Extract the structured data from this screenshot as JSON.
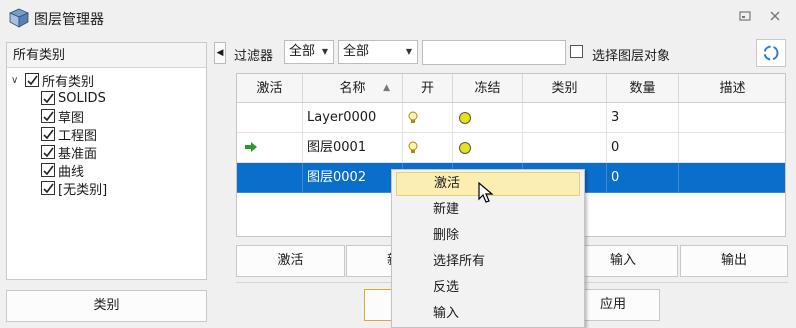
{
  "window": {
    "title": "图层管理器",
    "icons": [
      "layer-manager-app-icon",
      "restore-icon",
      "close-icon"
    ]
  },
  "tree": {
    "header": "所有类别",
    "items": [
      {
        "label": "所有类别",
        "checked": true,
        "level": 0,
        "expanded": true
      },
      {
        "label": "SOLIDS",
        "checked": true,
        "level": 1
      },
      {
        "label": "草图",
        "checked": true,
        "level": 1
      },
      {
        "label": "工程图",
        "checked": true,
        "level": 1
      },
      {
        "label": "基准面",
        "checked": true,
        "level": 1
      },
      {
        "label": "曲线",
        "checked": true,
        "level": 1
      },
      {
        "label": "[无类别]",
        "checked": true,
        "level": 1
      }
    ],
    "category_button": "类别"
  },
  "filter": {
    "label": "过滤器",
    "combo1": "全部",
    "combo2": "全部",
    "search_value": "",
    "select_objects_label": "选择图层对象",
    "select_objects_checked": false
  },
  "grid": {
    "columns": [
      "激活",
      "名称",
      "开",
      "冻结",
      "类别",
      "数量",
      "描述"
    ],
    "sort_column": "名称",
    "rows": [
      {
        "active": false,
        "name": "Layer0000",
        "on": true,
        "frozen": "yellow",
        "category": "",
        "count": "3",
        "desc": "",
        "selected": false
      },
      {
        "active": true,
        "name": "图层0001",
        "on": true,
        "frozen": "yellow",
        "category": "",
        "count": "0",
        "desc": "",
        "selected": false
      },
      {
        "active": false,
        "name": "图层0002",
        "on": true,
        "frozen": "yellow",
        "category": "",
        "count": "0",
        "desc": "",
        "selected": true
      }
    ]
  },
  "actions": {
    "activate": "激活",
    "new_partial": "新",
    "import": "输入",
    "export": "输出"
  },
  "footer": {
    "apply": "应用"
  },
  "context_menu": {
    "items": [
      "激活",
      "新建",
      "删除",
      "选择所有",
      "反选",
      "输入"
    ],
    "highlighted": "激活"
  },
  "colors": {
    "selection": "#0a6ecb",
    "highlight": "#fbeeb2",
    "active_arrow": "#2a9a2a",
    "freeze_dot": "#e6e21a"
  }
}
